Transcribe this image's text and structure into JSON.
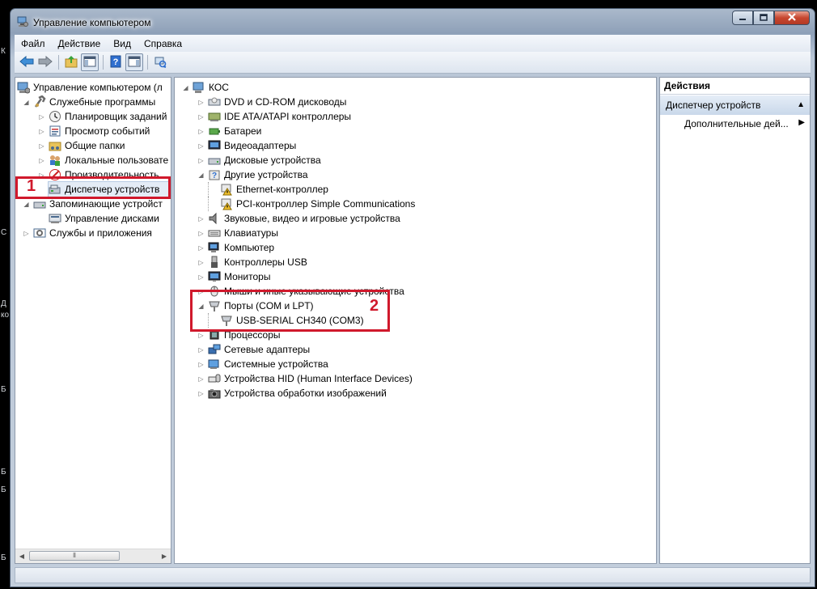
{
  "window": {
    "title": "Управление компьютером"
  },
  "background_fragments": [
    "К",
    "С",
    "Д",
    "ко",
    "Б",
    "Б",
    "Б",
    "Б"
  ],
  "menu": [
    "Файл",
    "Действие",
    "Вид",
    "Справка"
  ],
  "toolbar_icons": [
    "back-arrow-icon",
    "forward-arrow-icon",
    "up-folder-icon",
    "show-hide-console-tree-icon",
    "help-icon",
    "show-hide-action-pane-icon",
    "refresh-icon"
  ],
  "left_tree": [
    {
      "label": "Управление компьютером (л",
      "icon": "computer-management-icon",
      "toggle": "",
      "indent": 0
    },
    {
      "label": "Служебные программы",
      "icon": "tools-icon",
      "toggle": "◢",
      "indent": 1
    },
    {
      "label": "Планировщик заданий",
      "icon": "clock-icon",
      "toggle": "▷",
      "indent": 2
    },
    {
      "label": "Просмотр событий",
      "icon": "event-viewer-icon",
      "toggle": "▷",
      "indent": 2
    },
    {
      "label": "Общие папки",
      "icon": "shared-folder-icon",
      "toggle": "▷",
      "indent": 2
    },
    {
      "label": "Локальные пользовате",
      "icon": "users-icon",
      "toggle": "▷",
      "indent": 2
    },
    {
      "label": "Производительность",
      "icon": "performance-icon",
      "toggle": "▷",
      "indent": 2
    },
    {
      "label": "Диспетчер устройств",
      "icon": "device-manager-icon",
      "toggle": "",
      "indent": 2
    },
    {
      "label": "Запоминающие устройст",
      "icon": "storage-icon",
      "toggle": "◢",
      "indent": 1
    },
    {
      "label": "Управление дисками",
      "icon": "disk-management-icon",
      "toggle": "",
      "indent": 2
    },
    {
      "label": "Службы и приложения",
      "icon": "services-icon",
      "toggle": "▷",
      "indent": 1
    }
  ],
  "left_scroll_thumb": "⦀",
  "device_tree": {
    "root": "КОС",
    "items": [
      {
        "label": "DVD и CD-ROM дисководы",
        "icon": "dvd-drive-icon",
        "toggle": "▷",
        "indent": 1
      },
      {
        "label": "IDE ATA/ATAPI контроллеры",
        "icon": "ide-controller-icon",
        "toggle": "▷",
        "indent": 1
      },
      {
        "label": "Батареи",
        "icon": "battery-icon",
        "toggle": "▷",
        "indent": 1
      },
      {
        "label": "Видеоадаптеры",
        "icon": "display-adapter-icon",
        "toggle": "▷",
        "indent": 1
      },
      {
        "label": "Дисковые устройства",
        "icon": "disk-drive-icon",
        "toggle": "▷",
        "indent": 1
      },
      {
        "label": "Другие устройства",
        "icon": "unknown-device-icon",
        "toggle": "◢",
        "indent": 1
      },
      {
        "label": "Ethernet-контроллер",
        "icon": "warning-device-icon",
        "toggle": "",
        "indent": 2
      },
      {
        "label": "PCI-контроллер Simple Communications",
        "icon": "warning-device-icon",
        "toggle": "",
        "indent": 2
      },
      {
        "label": "Звуковые, видео и игровые устройства",
        "icon": "sound-icon",
        "toggle": "▷",
        "indent": 1
      },
      {
        "label": "Клавиатуры",
        "icon": "keyboard-icon",
        "toggle": "▷",
        "indent": 1
      },
      {
        "label": "Компьютер",
        "icon": "computer-icon",
        "toggle": "▷",
        "indent": 1
      },
      {
        "label": "Контроллеры USB",
        "icon": "usb-icon",
        "toggle": "▷",
        "indent": 1
      },
      {
        "label": "Мониторы",
        "icon": "monitor-icon",
        "toggle": "▷",
        "indent": 1
      },
      {
        "label": "Мыши и иные указывающие устройства",
        "icon": "mouse-icon",
        "toggle": "▷",
        "indent": 1
      },
      {
        "label": "Порты (COM и LPT)",
        "icon": "port-icon",
        "toggle": "◢",
        "indent": 1
      },
      {
        "label": "USB-SERIAL CH340 (COM3)",
        "icon": "port-icon",
        "toggle": "",
        "indent": 2
      },
      {
        "label": "Процессоры",
        "icon": "processor-icon",
        "toggle": "▷",
        "indent": 1
      },
      {
        "label": "Сетевые адаптеры",
        "icon": "network-adapter-icon",
        "toggle": "▷",
        "indent": 1
      },
      {
        "label": "Системные устройства",
        "icon": "system-device-icon",
        "toggle": "▷",
        "indent": 1
      },
      {
        "label": "Устройства HID (Human Interface Devices)",
        "icon": "hid-icon",
        "toggle": "▷",
        "indent": 1
      },
      {
        "label": "Устройства обработки изображений",
        "icon": "imaging-device-icon",
        "toggle": "▷",
        "indent": 1
      }
    ]
  },
  "actions": {
    "header": "Действия",
    "section": "Диспетчер устройств",
    "more_actions": "Дополнительные дей..."
  },
  "annotations": [
    "1",
    "2"
  ],
  "colors": {
    "highlight_red": "#d0192c",
    "selection": "#e4ecf6"
  }
}
